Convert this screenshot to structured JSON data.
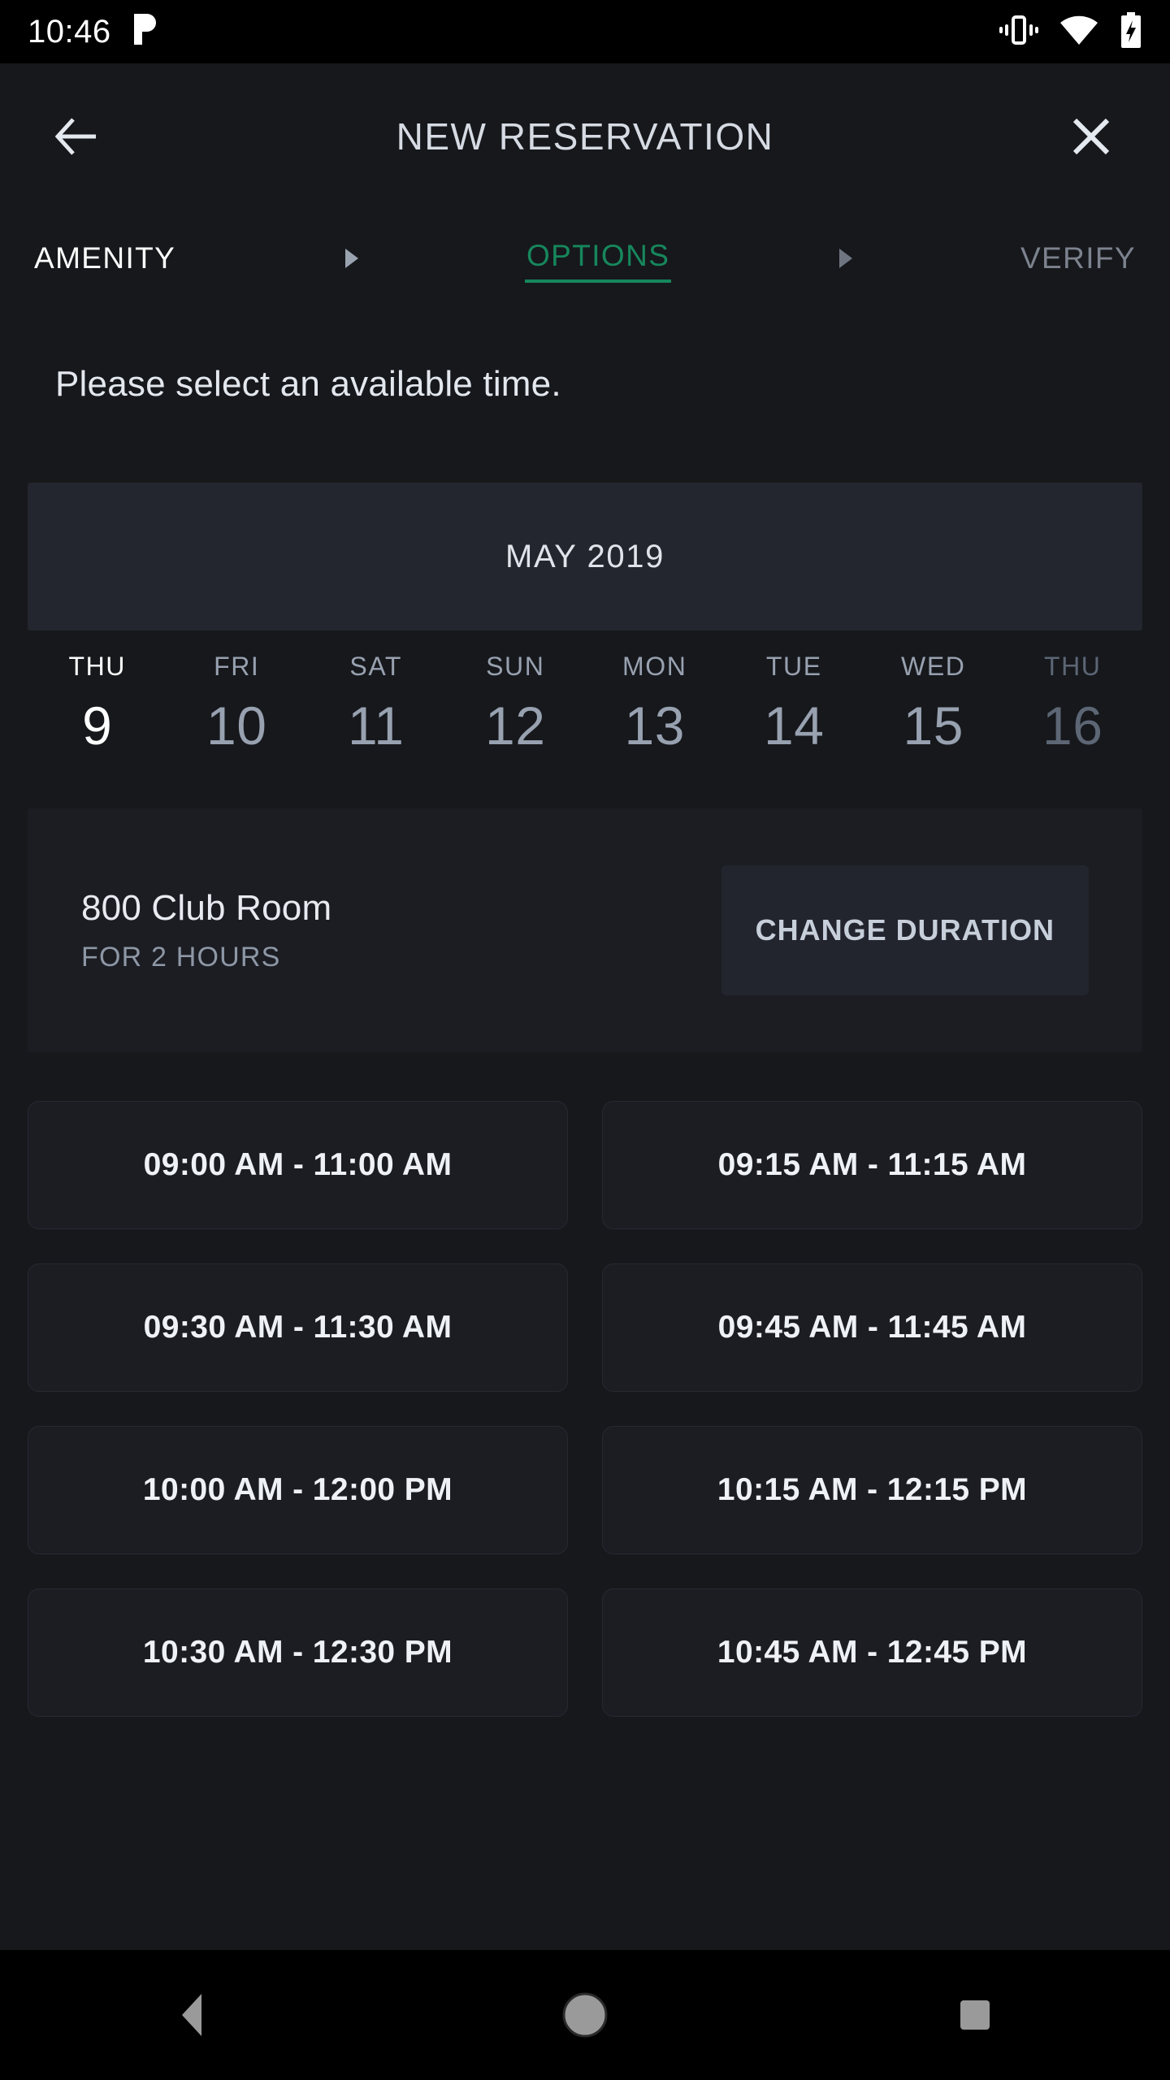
{
  "status_bar": {
    "clock": "10:46",
    "left_icon": "pandora-icon",
    "right_icons": [
      "vibrate-icon",
      "wifi-icon",
      "battery-charging-icon"
    ]
  },
  "app_bar": {
    "title": "NEW RESERVATION",
    "back_icon": "back-arrow-icon",
    "close_icon": "close-x-icon"
  },
  "steps": {
    "items": [
      {
        "label": "AMENITY",
        "state": "done"
      },
      {
        "label": "OPTIONS",
        "state": "active"
      },
      {
        "label": "VERIFY",
        "state": "upcoming"
      }
    ],
    "separator_icon": "triangle-right-icon"
  },
  "instruction": "Please select an available time.",
  "calendar": {
    "month_label": "MAY 2019",
    "days": [
      {
        "dow": "THU",
        "num": "9",
        "state": "selected"
      },
      {
        "dow": "FRI",
        "num": "10",
        "state": "normal"
      },
      {
        "dow": "SAT",
        "num": "11",
        "state": "normal"
      },
      {
        "dow": "SUN",
        "num": "12",
        "state": "normal"
      },
      {
        "dow": "MON",
        "num": "13",
        "state": "normal"
      },
      {
        "dow": "TUE",
        "num": "14",
        "state": "normal"
      },
      {
        "dow": "WED",
        "num": "15",
        "state": "normal"
      },
      {
        "dow": "THU",
        "num": "16",
        "state": "dim"
      }
    ]
  },
  "amenity": {
    "name": "800 Club Room",
    "duration_label": "FOR 2 HOURS",
    "change_duration_button": "CHANGE DURATION"
  },
  "time_slots": [
    "09:00 AM - 11:00 AM",
    "09:15 AM - 11:15 AM",
    "09:30 AM - 11:30 AM",
    "09:45 AM - 11:45 AM",
    "10:00 AM - 12:00 PM",
    "10:15 AM - 12:15 PM",
    "10:30 AM - 12:30 PM",
    "10:45 AM - 12:45 PM"
  ],
  "nav_bar": {
    "back_icon": "nav-back-triangle-icon",
    "home_icon": "nav-home-circle-icon",
    "recents_icon": "nav-recents-square-icon"
  },
  "colors": {
    "page_background": "#16181c",
    "status_bar": "#000000",
    "card": "#1b1d23",
    "month_bar": "#24262f",
    "accent_green": "#16875c",
    "text_primary": "#e7eaf0",
    "text_muted": "#98a1b0"
  }
}
